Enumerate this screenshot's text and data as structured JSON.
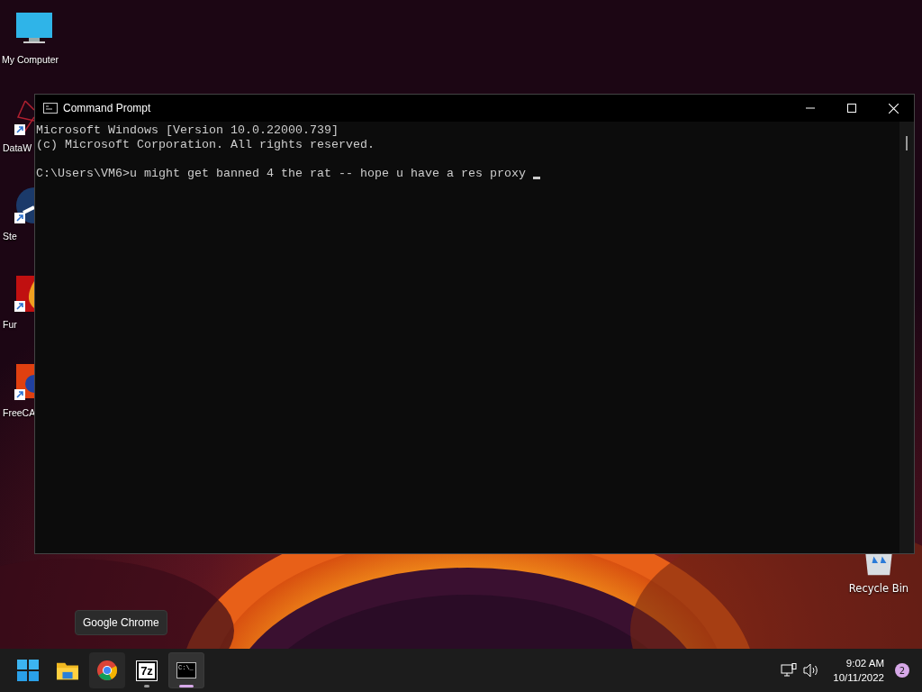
{
  "desktop_icons": [
    {
      "kind": "monitor",
      "label": "My Computer"
    },
    {
      "kind": "datawrapper",
      "label": "DataW",
      "shortcut": true
    },
    {
      "kind": "steam",
      "label": "Ste",
      "shortcut": true
    },
    {
      "kind": "furmark",
      "label": "Fur",
      "shortcut": true
    },
    {
      "kind": "freecad",
      "label": "FreeCA",
      "shortcut": true
    }
  ],
  "recycle_bin": {
    "label": "Recycle Bin"
  },
  "window": {
    "title": "Command Prompt",
    "lines": [
      {
        "kind": "output",
        "text": "Microsoft Windows [Version 10.0.22000.739]"
      },
      {
        "kind": "output",
        "text": "(c) Microsoft Corporation. All rights reserved."
      },
      {
        "kind": "prompt",
        "text": "C:\\Users\\VM6>u might get banned 4 the rat -- hope u have a res proxy "
      }
    ]
  },
  "tooltip": {
    "text": "Google Chrome"
  },
  "taskbar": {
    "apps": [
      {
        "kind": "start",
        "running": false,
        "selected": false,
        "hovered": false
      },
      {
        "kind": "explorer",
        "running": false,
        "selected": false,
        "hovered": false
      },
      {
        "kind": "chrome",
        "running": false,
        "selected": false,
        "hovered": true
      },
      {
        "kind": "sevenzip",
        "running": true,
        "selected": false,
        "hovered": false,
        "label": "7z"
      },
      {
        "kind": "cmd",
        "running": true,
        "selected": true,
        "hovered": false,
        "label": "C:\\_"
      }
    ],
    "time": "9:02 AM",
    "date": "10/11/2022",
    "notifications": "2"
  }
}
